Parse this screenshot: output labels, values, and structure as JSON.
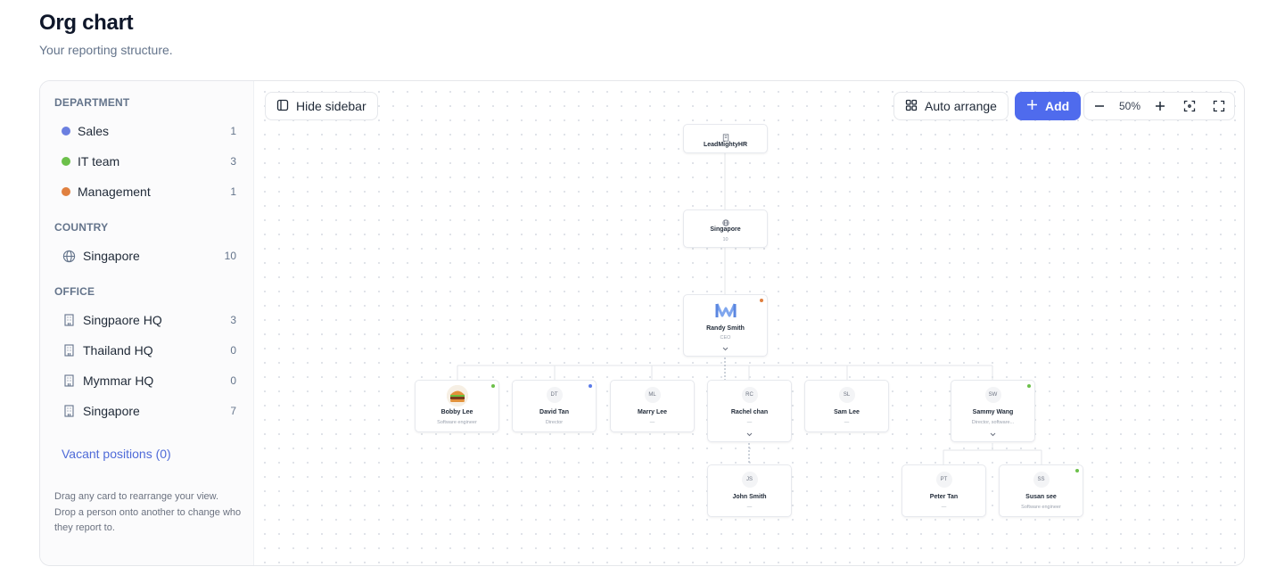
{
  "header": {
    "title": "Org chart",
    "subtitle": "Your reporting structure."
  },
  "sidebar": {
    "department_heading": "DEPARTMENT",
    "departments": [
      {
        "label": "Sales",
        "count": "1",
        "color": "#6b7fe0"
      },
      {
        "label": "IT team",
        "count": "3",
        "color": "#6cc04a"
      },
      {
        "label": "Management",
        "count": "1",
        "color": "#e08040"
      }
    ],
    "country_heading": "COUNTRY",
    "countries": [
      {
        "label": "Singapore",
        "count": "10",
        "icon": "globe-icon"
      }
    ],
    "office_heading": "OFFICE",
    "offices": [
      {
        "label": "Singpaore HQ",
        "count": "3",
        "icon": "building-icon"
      },
      {
        "label": "Thailand HQ",
        "count": "0",
        "icon": "building-icon"
      },
      {
        "label": "Mymmar HQ",
        "count": "0",
        "icon": "building-icon"
      },
      {
        "label": "Singapore",
        "count": "7",
        "icon": "building-icon"
      }
    ],
    "vacant_label": "Vacant positions (0)",
    "help_text": "Drag any card to rearrange your view. Drop a person onto another to change who they report to."
  },
  "toolbar": {
    "hide_sidebar_label": "Hide sidebar",
    "auto_arrange_label": "Auto arrange",
    "add_label": "Add",
    "zoom_value": "50%"
  },
  "chart": {
    "root": {
      "name": "LeadMightyHR"
    },
    "country": {
      "name": "Singapore",
      "count": "10"
    },
    "ceo": {
      "name": "Randy Smith",
      "role": "CEO"
    },
    "people": {
      "bobby": {
        "name": "Bobby Lee",
        "role": "Software engineer"
      },
      "david": {
        "initials": "DT",
        "name": "David Tan",
        "role": "Director"
      },
      "marry": {
        "initials": "ML",
        "name": "Marry Lee",
        "role": "—"
      },
      "rachel": {
        "initials": "RC",
        "name": "Rachel chan",
        "role": "—"
      },
      "sam": {
        "initials": "SL",
        "name": "Sam Lee",
        "role": "—"
      },
      "sammy": {
        "initials": "SW",
        "name": "Sammy Wang",
        "role": "Director, software..."
      },
      "john": {
        "initials": "JS",
        "name": "John Smith",
        "role": "—"
      },
      "peter": {
        "initials": "PT",
        "name": "Peter Tan",
        "role": "—"
      },
      "susan": {
        "initials": "SS",
        "name": "Susan see",
        "role": "Software engineer"
      }
    },
    "status_colors": {
      "green": "#6cc04a",
      "blue": "#5b7be8",
      "orange": "#e08040"
    }
  }
}
